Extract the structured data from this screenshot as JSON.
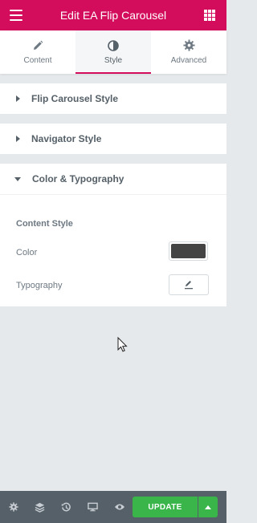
{
  "header": {
    "title": "Edit EA Flip Carousel"
  },
  "tabs": [
    {
      "label": "Content"
    },
    {
      "label": "Style"
    },
    {
      "label": "Advanced"
    }
  ],
  "sections": [
    {
      "title": "Flip Carousel Style"
    },
    {
      "title": "Navigator Style"
    },
    {
      "title": "Color & Typography"
    }
  ],
  "panel": {
    "group_heading": "Content Style",
    "color_label": "Color",
    "color_value": "#444444",
    "typography_label": "Typography"
  },
  "footer": {
    "update_label": "UPDATE"
  },
  "colors": {
    "brand": "#d30c5c",
    "update": "#39b54a",
    "footer": "#556068"
  }
}
